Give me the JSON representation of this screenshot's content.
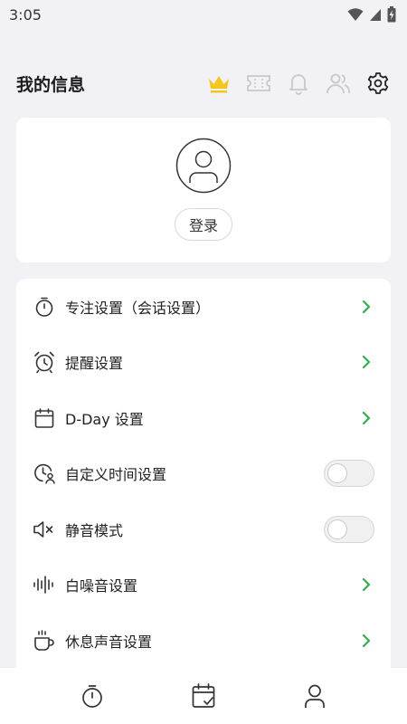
{
  "status_bar": {
    "time": "3:05",
    "icons": [
      "wifi-icon",
      "signal-icon",
      "battery-charging-icon"
    ]
  },
  "header": {
    "title": "我的信息",
    "icons": [
      "crown-icon",
      "ticket-icon",
      "bell-icon",
      "users-icon",
      "gear-icon"
    ],
    "accent_color": "#f5c518"
  },
  "profile": {
    "login_label": "登录"
  },
  "settings": {
    "items": [
      {
        "label": "专注设置（会话设置）",
        "icon": "stopwatch-icon",
        "control": "chevron"
      },
      {
        "label": "提醒设置",
        "icon": "alarm-clock-icon",
        "control": "chevron"
      },
      {
        "label": "D-Day 设置",
        "icon": "calendar-icon",
        "control": "chevron"
      },
      {
        "label": "自定义时间设置",
        "icon": "clock-person-icon",
        "control": "toggle",
        "value": false
      },
      {
        "label": "静音模式",
        "icon": "speaker-mute-icon",
        "control": "toggle",
        "value": false
      },
      {
        "label": "白噪音设置",
        "icon": "sound-wave-icon",
        "control": "chevron"
      },
      {
        "label": "休息声音设置",
        "icon": "coffee-cup-icon",
        "control": "chevron"
      }
    ],
    "chevron_color": "#2bb34a"
  },
  "bottom_nav": {
    "items": [
      "timer-tab-icon",
      "calendar-check-tab-icon",
      "profile-tab-icon"
    ]
  }
}
